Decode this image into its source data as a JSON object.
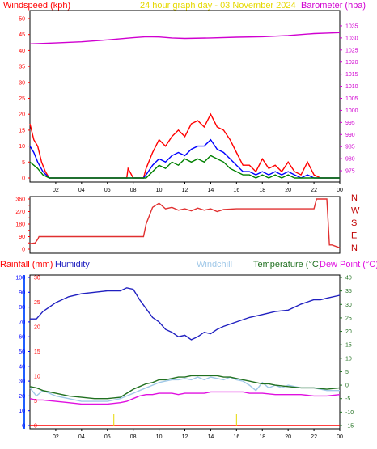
{
  "header": {
    "left_title": "Windspeed (kph)",
    "center_title": "24 hour graph day - 03 November 2024",
    "right_title": "Barometer (hpa)"
  },
  "colors": {
    "frame": "#000000",
    "wind_gust": "#ff0000",
    "wind_avg": "#0000ff",
    "wind_low": "#008000",
    "barometer": "#d000d0",
    "direction": "#e03030",
    "humidity": "#2020c0",
    "windchill": "#a0c8e8",
    "temperature": "#207020",
    "dewpoint": "#e010e0",
    "rainfall": "#ff0000",
    "title_yellow": "#e6d800"
  },
  "bottom": {
    "rain_label": "Rainfall (mm)",
    "humidity_label": "Humidity",
    "windchill_label": "Windchill",
    "temperature_label": "Temperature (°C)",
    "dewpoint_label": "Dew Point (°C)"
  },
  "direction_labels": [
    "N",
    "W",
    "S",
    "E",
    "N"
  ],
  "chart_data": [
    {
      "type": "line",
      "id": "wind-barometer",
      "title": "24 hour graph day - 03 November 2024",
      "ylabel": "Windspeed (kph)",
      "y2label": "Barometer (hpa)",
      "ylim": [
        0,
        50
      ],
      "y2lim": [
        972,
        1038
      ],
      "yticks": [
        0,
        5,
        10,
        15,
        20,
        25,
        30,
        35,
        40,
        45,
        50
      ],
      "y2ticks": [
        975,
        980,
        985,
        990,
        995,
        1000,
        1005,
        1010,
        1015,
        1020,
        1025,
        1030,
        1035
      ],
      "xticks": [
        "02",
        "04",
        "06",
        "08",
        "10",
        "12",
        "14",
        "16",
        "18",
        "20",
        "22",
        "00"
      ],
      "xlim": [
        0,
        24
      ],
      "grid": false,
      "series": [
        {
          "name": "Windspeed (kph)",
          "axis": "left",
          "color": "#ff0000",
          "x": [
            0,
            0.3,
            0.6,
            0.9,
            1.2,
            1.5,
            2,
            4,
            6,
            7.5,
            7.6,
            8,
            8.8,
            9,
            9.5,
            10,
            10.5,
            11,
            11.5,
            12,
            12.5,
            13,
            13.5,
            14,
            14.5,
            15,
            15.5,
            16,
            16.5,
            17,
            17.5,
            18,
            18.5,
            19,
            19.5,
            20,
            20.5,
            21,
            21.5,
            22,
            22.5,
            23,
            24
          ],
          "y": [
            17,
            12,
            10,
            5,
            2,
            0,
            0,
            0,
            0,
            0,
            3,
            0,
            0,
            3,
            8,
            12,
            10,
            13,
            15,
            13,
            17,
            18,
            16,
            20,
            16,
            15,
            12,
            8,
            4,
            4,
            2,
            6,
            3,
            4,
            2,
            5,
            2,
            1,
            5,
            1,
            0,
            0,
            0
          ]
        },
        {
          "name": "Windspeed avg",
          "axis": "left",
          "color": "#0000ff",
          "x": [
            0,
            0.3,
            0.6,
            1,
            1.5,
            2,
            6,
            8.8,
            9,
            9.5,
            10,
            10.5,
            11,
            11.5,
            12,
            12.5,
            13,
            13.5,
            14,
            14.5,
            15,
            15.5,
            16,
            16.5,
            17,
            17.5,
            18,
            18.5,
            19,
            19.5,
            20,
            20.5,
            21,
            21.5,
            22,
            24
          ],
          "y": [
            10,
            8,
            5,
            2,
            0,
            0,
            0,
            0,
            1,
            4,
            6,
            5,
            7,
            8,
            7,
            9,
            10,
            10,
            12,
            9,
            8,
            6,
            4,
            2,
            2,
            1,
            2,
            1,
            2,
            1,
            2,
            1,
            0,
            1,
            0,
            0
          ]
        },
        {
          "name": "Windspeed low",
          "axis": "left",
          "color": "#008000",
          "x": [
            0,
            0.3,
            0.6,
            1,
            1.5,
            2,
            6,
            8.8,
            9,
            9.5,
            10,
            10.5,
            11,
            11.5,
            12,
            12.5,
            13,
            13.5,
            14,
            14.5,
            15,
            15.5,
            16,
            16.5,
            17,
            17.5,
            18,
            18.5,
            19,
            19.5,
            20,
            20.5,
            21,
            21.5,
            22,
            24
          ],
          "y": [
            5,
            4,
            3,
            1,
            0,
            0,
            0,
            0,
            0,
            2,
            4,
            3,
            5,
            4,
            6,
            5,
            6,
            5,
            7,
            6,
            5,
            3,
            2,
            1,
            1,
            0,
            1,
            0,
            1,
            0,
            1,
            0,
            0,
            0,
            0,
            0
          ]
        },
        {
          "name": "Barometer (hpa)",
          "axis": "right",
          "color": "#d000d0",
          "x": [
            0,
            2,
            4,
            6,
            8,
            9,
            10,
            11,
            12,
            14,
            16,
            18,
            20,
            22,
            23,
            24
          ],
          "y": [
            1027.5,
            1027.9,
            1028.4,
            1029.2,
            1030.1,
            1030.5,
            1030.4,
            1030.0,
            1029.8,
            1030.0,
            1030.3,
            1030.5,
            1031.0,
            1031.8,
            1032.0,
            1032.2
          ]
        }
      ]
    },
    {
      "type": "line",
      "id": "wind-direction",
      "ylim": [
        0,
        360
      ],
      "yticks": [
        0,
        45,
        90,
        135,
        180,
        225,
        270,
        315,
        360
      ],
      "ytick_labels": [
        "0",
        "",
        "90",
        "",
        "180",
        "",
        "270",
        "",
        "360"
      ],
      "xlim": [
        0,
        24
      ],
      "series": [
        {
          "name": "Wind direction",
          "color": "#e03030",
          "x": [
            0,
            0.4,
            0.6,
            0.7,
            8.8,
            9.0,
            9.5,
            10,
            10.5,
            11,
            11.5,
            12,
            12.5,
            13,
            13.5,
            14,
            14.5,
            15,
            16,
            17,
            18,
            19,
            20,
            21,
            22,
            22.2,
            22.4,
            23,
            23.1,
            23.2,
            23.4,
            24
          ],
          "y": [
            40,
            45,
            70,
            90,
            90,
            180,
            300,
            330,
            290,
            300,
            280,
            290,
            275,
            295,
            280,
            290,
            270,
            285,
            290,
            290,
            290,
            290,
            290,
            290,
            290,
            360,
            360,
            360,
            200,
            30,
            30,
            10
          ]
        }
      ]
    },
    {
      "type": "line",
      "id": "humidity-temperature",
      "ylabel": "Humidity",
      "y2label": "Temperature (°C)",
      "ylim": [
        0,
        100
      ],
      "y2lim": [
        -15,
        40
      ],
      "yticks": [
        0,
        10,
        20,
        30,
        40,
        50,
        60,
        70,
        80,
        90,
        100
      ],
      "rain_ticks": [
        0,
        5,
        10,
        15,
        20,
        25,
        30
      ],
      "y2ticks": [
        -15,
        -10,
        -5,
        0,
        5,
        10,
        15,
        20,
        25,
        30,
        35,
        40
      ],
      "xticks": [
        "02",
        "04",
        "06",
        "08",
        "10",
        "12",
        "14",
        "16",
        "18",
        "20",
        "22",
        "00"
      ],
      "xlim": [
        0,
        24
      ],
      "series": [
        {
          "name": "Humidity",
          "axis": "left",
          "color": "#2020c0",
          "x": [
            0,
            0.5,
            1,
            2,
            3,
            4,
            5,
            6,
            7,
            7.5,
            8,
            8.5,
            9,
            9.5,
            10,
            10.5,
            11,
            11.5,
            12,
            12.5,
            13,
            13.5,
            14,
            14.5,
            15,
            16,
            17,
            18,
            19,
            20,
            21,
            22,
            22.5,
            23,
            24
          ],
          "y": [
            72,
            72,
            77,
            83,
            87,
            89,
            90,
            91,
            91,
            93,
            92,
            85,
            79,
            73,
            70,
            65,
            63,
            60,
            61,
            58,
            60,
            63,
            62,
            65,
            67,
            70,
            73,
            75,
            77,
            78,
            82,
            85,
            85,
            86,
            88
          ]
        },
        {
          "name": "Windchill",
          "axis": "right",
          "color": "#a0c8e8",
          "x": [
            0,
            0.5,
            1,
            2,
            3,
            4,
            5,
            6,
            7,
            7.5,
            8,
            8.5,
            9,
            9.5,
            10,
            10.5,
            11,
            11.5,
            12,
            12.5,
            13,
            13.5,
            14,
            14.5,
            15,
            15.5,
            16,
            16.5,
            17,
            17.5,
            18,
            18.5,
            19,
            19.5,
            20,
            21,
            22,
            23,
            24
          ],
          "y": [
            -1,
            -4,
            -2,
            -4,
            -5,
            -6,
            -6,
            -6,
            -5,
            -4,
            -3,
            -2,
            -1,
            0,
            1,
            1.5,
            2,
            2,
            2.5,
            2,
            3,
            2,
            3,
            2.5,
            2,
            3,
            2,
            1.5,
            0,
            -2,
            1,
            -1,
            0,
            -1,
            0,
            -1,
            -1,
            -2,
            -2
          ]
        },
        {
          "name": "Temperature (°C)",
          "axis": "right",
          "color": "#207020",
          "x": [
            0,
            0.5,
            1,
            2,
            3,
            4,
            5,
            6,
            7,
            7.5,
            8,
            8.5,
            9,
            9.5,
            10,
            10.5,
            11,
            11.5,
            12,
            12.5,
            13,
            13.5,
            14,
            14.5,
            15,
            15.5,
            16,
            16.5,
            17,
            17.5,
            18,
            18.5,
            19,
            20,
            21,
            22,
            23,
            24
          ],
          "y": [
            -0.5,
            -1,
            -2,
            -3,
            -4,
            -4.5,
            -5,
            -5,
            -4.5,
            -3,
            -1.5,
            -0.5,
            0.5,
            1,
            2,
            2,
            2.5,
            3,
            3,
            3.5,
            3.5,
            3.5,
            3.5,
            3.5,
            3,
            3,
            2.5,
            2,
            1.5,
            1,
            0.5,
            0.5,
            0,
            -0.5,
            -1,
            -1,
            -1.5,
            -1
          ]
        },
        {
          "name": "Dew Point (°C)",
          "axis": "right",
          "color": "#e010e0",
          "x": [
            0,
            0.5,
            1,
            2,
            3,
            4,
            5,
            6,
            7,
            7.5,
            8,
            8.5,
            9,
            9.5,
            10,
            10.5,
            11,
            11.5,
            12,
            12.5,
            13,
            13.5,
            14,
            14.5,
            15,
            15.5,
            16,
            16.5,
            17,
            17.5,
            18,
            19,
            20,
            21,
            22,
            23,
            24
          ],
          "y": [
            -5,
            -5.5,
            -5.5,
            -6,
            -6.5,
            -7,
            -7,
            -7,
            -6.5,
            -6,
            -5,
            -4,
            -3.5,
            -3.5,
            -3,
            -3,
            -3,
            -3.5,
            -3,
            -3,
            -3,
            -3,
            -2.5,
            -2.5,
            -2.5,
            -2.5,
            -2.5,
            -2.5,
            -3,
            -3,
            -3,
            -3.5,
            -3.5,
            -3.5,
            -4,
            -4,
            -3.5
          ]
        },
        {
          "name": "Rainfall (mm)",
          "axis": "rain",
          "color": "#ff0000",
          "x": [
            0,
            24
          ],
          "y": [
            0,
            0
          ]
        }
      ],
      "markers": [
        6.5,
        16
      ]
    }
  ]
}
